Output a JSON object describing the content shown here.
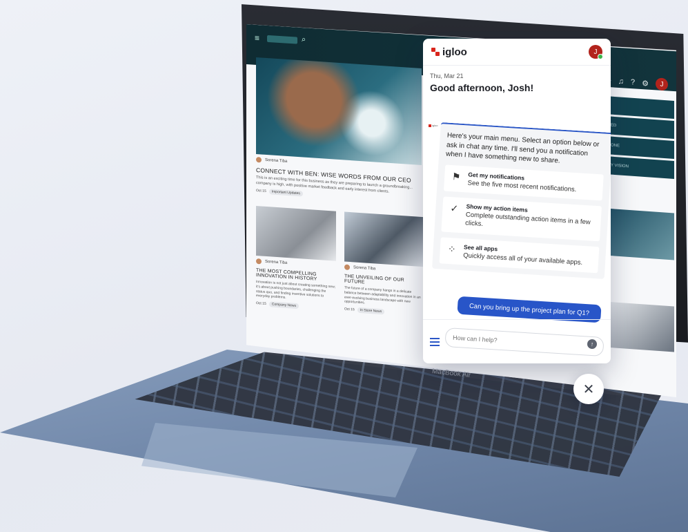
{
  "app": {
    "brand": "igloo",
    "device_label": "MacBook Air",
    "accent_color": "#2855c8",
    "brand_color": "#d9251c"
  },
  "background_intranet": {
    "hero_author": "Sorena Tiba",
    "hero_headline": "CONNECT WITH BEN: WISE WORDS FROM OUR CEO",
    "hero_excerpt": "This is an exciting time for this business as they are preparing to launch a groundbreaking... company is high, with positive market feedback and early interest from clients.",
    "hero_date": "Oct 15",
    "hero_tag": "Important Updates",
    "card1_author": "Sorena Tiba",
    "card1_headline": "THE MOST COMPELLING INNOVATION IN HISTORY",
    "card1_excerpt": "Innovation is not just about creating something new; it's about pushing boundaries, challenging the status quo, and finding inventive solutions to everyday problems.",
    "card1_date": "Oct 15",
    "card1_tag": "Company News",
    "card2_author": "Sorena Tiba",
    "card2_headline": "THE UNVEILING OF OUR FUTURE",
    "card2_excerpt": "The future of a company hangs in a delicate balance between adaptability and innovation in an ever-evolving business landscape with new opportunities.",
    "card2_date": "Oct 15",
    "card2_tag": "In Store News",
    "sidebar_rows": [
      "",
      "ED",
      "ONE",
      "Y VISION"
    ],
    "topbar_avatar": "J"
  },
  "chat": {
    "user_initial": "J",
    "date": "Thu, Mar 21",
    "greeting": "Good afternoon, Josh!",
    "bot_label": "igloo",
    "intro": "Here's your main menu. Select an option below or ask in chat any time. I'll send you a notification when I have something new to share.",
    "options": [
      {
        "icon": "flag-icon",
        "title": "Get my notifications",
        "desc": "See the five most recent notifications."
      },
      {
        "icon": "check-circle-icon",
        "title": "Show my action items",
        "desc": "Complete outstanding action items in a few clicks."
      },
      {
        "icon": "apps-grid-icon",
        "title": "See all apps",
        "desc": "Quickly access all of your available apps."
      }
    ],
    "user_message": "Can you bring up the project plan for Q1?",
    "input_placeholder": "How can I help?"
  }
}
